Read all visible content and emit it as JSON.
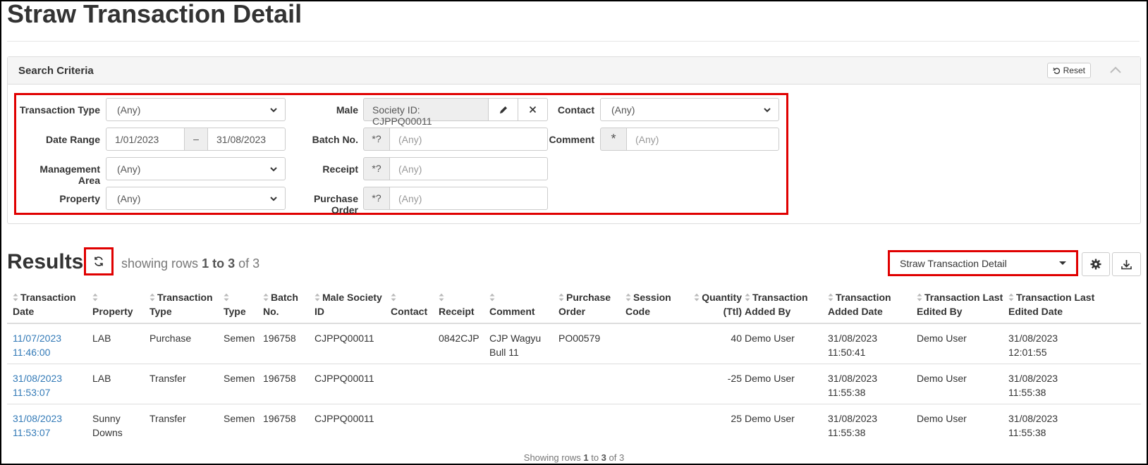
{
  "page": {
    "title": "Straw Transaction Detail"
  },
  "search": {
    "title": "Search Criteria",
    "reset_label": "Reset",
    "labels": {
      "transaction_type": "Transaction Type",
      "date_range": "Date Range",
      "management_area": "Management Area",
      "property": "Property",
      "male": "Male",
      "batch_no": "Batch No.",
      "receipt": "Receipt",
      "purchase_order": "Purchase Order",
      "contact": "Contact",
      "comment": "Comment"
    },
    "values": {
      "transaction_type": "(Any)",
      "date_from": "1/01/2023",
      "date_sep": "–",
      "date_to": "31/08/2023",
      "management_area": "(Any)",
      "property": "(Any)",
      "male": "Society ID: CJPPQ00011",
      "contact": "(Any)"
    },
    "placeholders": {
      "batch_no": "(Any)",
      "receipt": "(Any)",
      "purchase_order": "(Any)",
      "comment": "(Any)"
    },
    "addons": {
      "wildcard": "*?",
      "star": "*"
    }
  },
  "results": {
    "title": "Results",
    "showing_prefix": "showing rows",
    "showing_range": "1 to 3",
    "showing_of": "of 3",
    "report_select": "Straw Transaction Detail",
    "footer_prefix": "Showing rows",
    "footer_from": "1",
    "footer_to_word": "to",
    "footer_to": "3",
    "footer_of": "of 3"
  },
  "table": {
    "headers": [
      [
        "Transaction",
        "Date"
      ],
      [
        "",
        "Property"
      ],
      [
        "Transaction",
        "Type"
      ],
      [
        "",
        "Type"
      ],
      [
        "Batch",
        "No."
      ],
      [
        "Male Society",
        "ID"
      ],
      [
        "",
        "Contact"
      ],
      [
        "",
        "Receipt"
      ],
      [
        "",
        "Comment"
      ],
      [
        "Purchase",
        "Order"
      ],
      [
        "Session",
        "Code"
      ],
      [
        "Quantity",
        "(Ttl)"
      ],
      [
        "Transaction",
        "Added By"
      ],
      [
        "Transaction",
        "Added Date"
      ],
      [
        "Transaction Last",
        "Edited By"
      ],
      [
        "Transaction Last",
        "Edited Date"
      ]
    ],
    "rows": [
      {
        "date": [
          "11/07/2023",
          "11:46:00"
        ],
        "property": [
          "LAB",
          ""
        ],
        "txn_type": "Purchase",
        "type": "Semen",
        "batch": "196758",
        "male": "CJPPQ00011",
        "contact": "",
        "receipt": "0842CJP",
        "comment": [
          "CJP Wagyu",
          "Bull 11"
        ],
        "po": "PO00579",
        "session": "",
        "qty": "40",
        "added_by": "Demo User",
        "added_date": [
          "31/08/2023",
          "11:50:41"
        ],
        "edited_by": "Demo User",
        "edited_date": [
          "31/08/2023",
          "12:01:55"
        ]
      },
      {
        "date": [
          "31/08/2023",
          "11:53:07"
        ],
        "property": [
          "LAB",
          ""
        ],
        "txn_type": "Transfer",
        "type": "Semen",
        "batch": "196758",
        "male": "CJPPQ00011",
        "contact": "",
        "receipt": "",
        "comment": [
          "",
          ""
        ],
        "po": "",
        "session": "",
        "qty": "-25",
        "added_by": "Demo User",
        "added_date": [
          "31/08/2023",
          "11:55:38"
        ],
        "edited_by": "Demo User",
        "edited_date": [
          "31/08/2023",
          "11:55:38"
        ]
      },
      {
        "date": [
          "31/08/2023",
          "11:53:07"
        ],
        "property": [
          "Sunny",
          "Downs"
        ],
        "txn_type": "Transfer",
        "type": "Semen",
        "batch": "196758",
        "male": "CJPPQ00011",
        "contact": "",
        "receipt": "",
        "comment": [
          "",
          ""
        ],
        "po": "",
        "session": "",
        "qty": "25",
        "added_by": "Demo User",
        "added_date": [
          "31/08/2023",
          "11:55:38"
        ],
        "edited_by": "Demo User",
        "edited_date": [
          "31/08/2023",
          "11:55:38"
        ]
      }
    ]
  },
  "colors": {
    "highlight": "#e00000",
    "link": "#337ab7"
  },
  "icons": [
    "undo-icon",
    "chevron-up-icon",
    "chevron-down-icon",
    "pencil-icon",
    "close-icon",
    "refresh-icon",
    "gear-icon",
    "download-icon",
    "sort-icon"
  ]
}
